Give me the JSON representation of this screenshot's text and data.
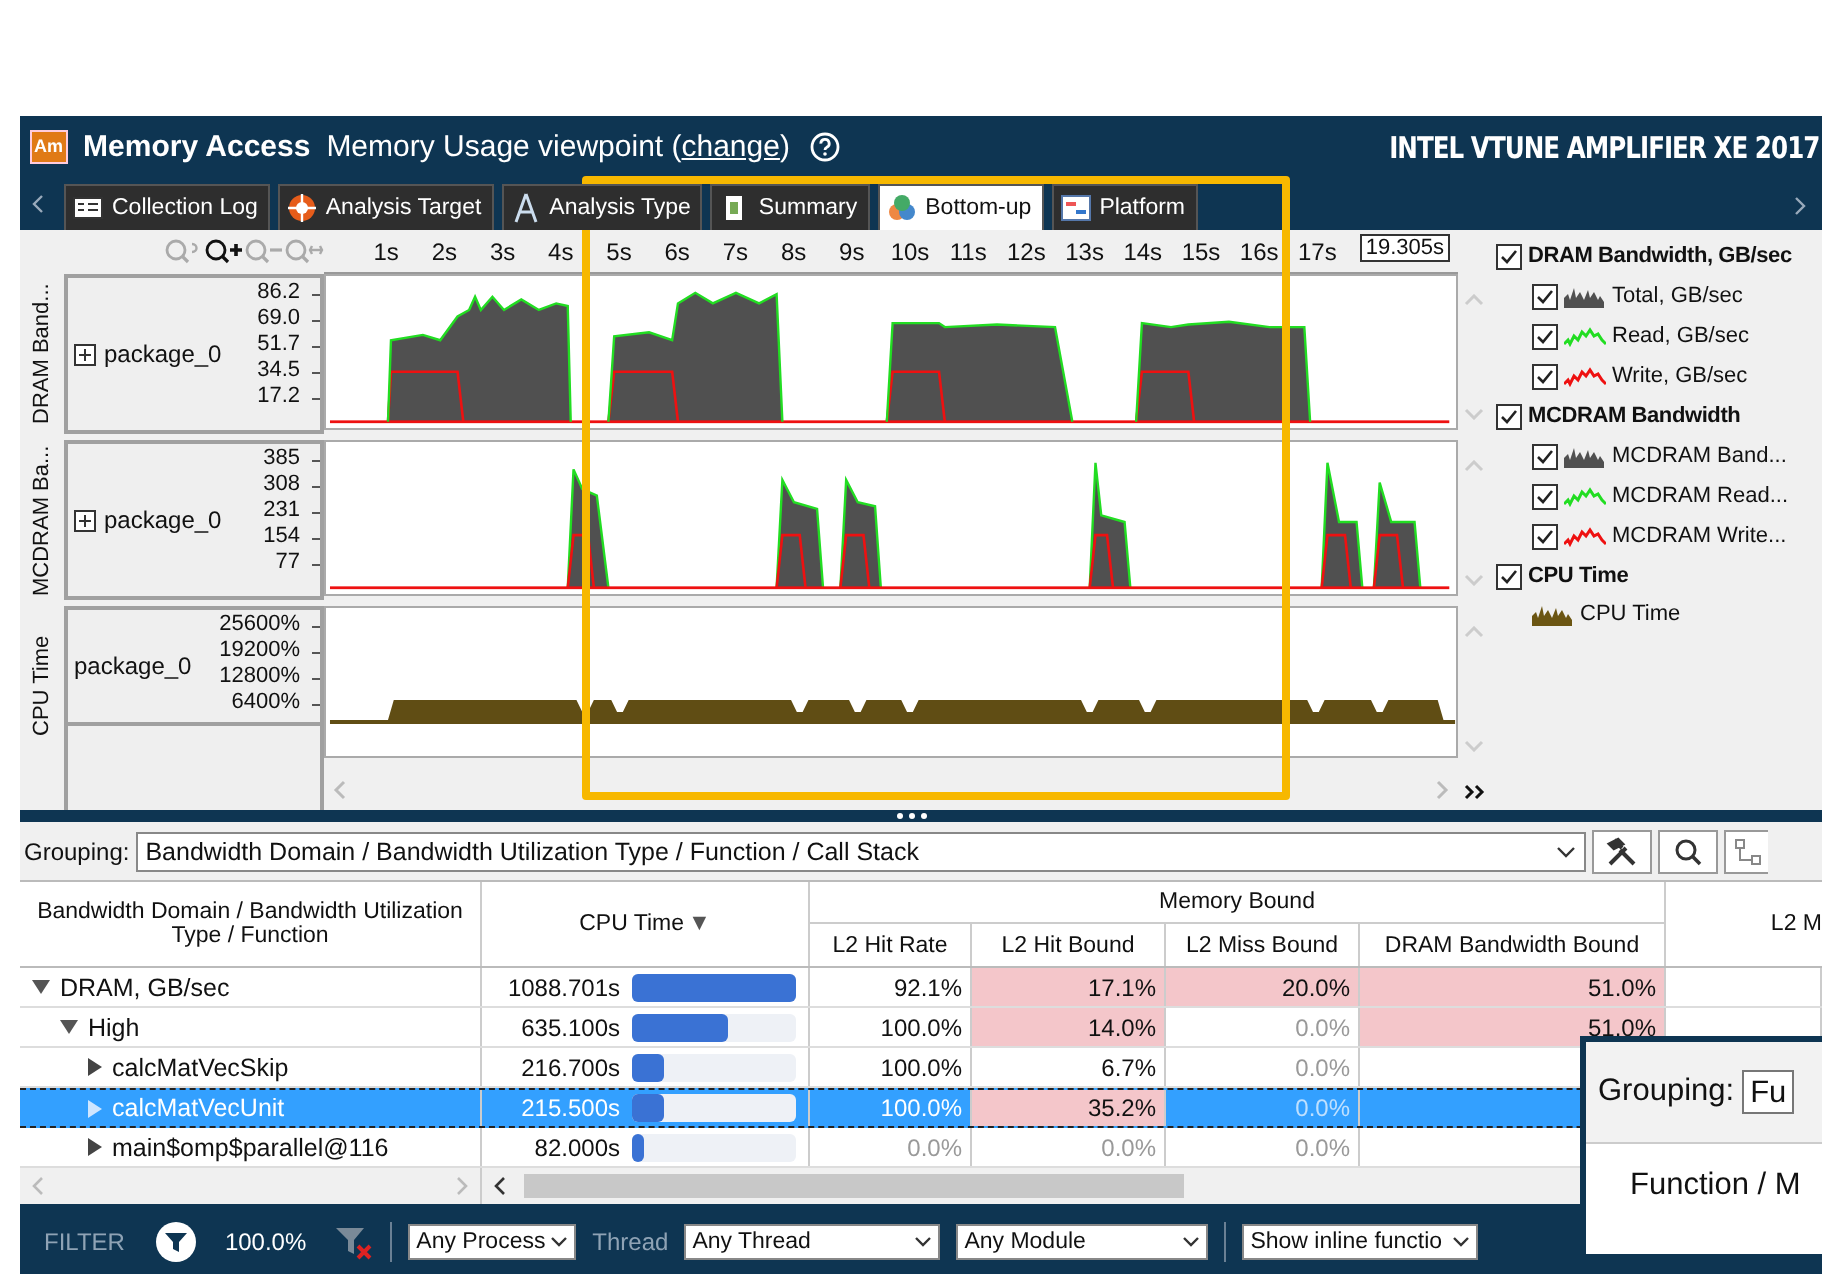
{
  "header": {
    "logo_text": "Am",
    "title": "Memory Access",
    "viewpoint": "Memory Usage viewpoint (",
    "viewpoint_link": "change",
    "viewpoint_end": ")",
    "brand": "INTEL VTUNE AMPLIFIER XE 2017"
  },
  "tabs": [
    {
      "label": "Collection Log",
      "selected": false
    },
    {
      "label": "Analysis Target",
      "selected": false
    },
    {
      "label": "Analysis Type",
      "selected": false
    },
    {
      "label": "Summary",
      "selected": false
    },
    {
      "label": "Bottom-up",
      "selected": true
    },
    {
      "label": "Platform",
      "selected": false
    }
  ],
  "timeline": {
    "time_ticks": [
      "1s",
      "2s",
      "3s",
      "4s",
      "5s",
      "6s",
      "7s",
      "8s",
      "9s",
      "10s",
      "11s",
      "12s",
      "13s",
      "14s",
      "15s",
      "16s",
      "17s"
    ],
    "end_time": "19.305s",
    "rows": [
      {
        "label": "DRAM Band...",
        "item": "package_0",
        "expandable": true,
        "scale": [
          "86.2",
          "69.0",
          "51.7",
          "34.5",
          "17.2"
        ]
      },
      {
        "label": "MCDRAM Ba...",
        "item": "package_0",
        "expandable": true,
        "scale": [
          "385",
          "308",
          "231",
          "154",
          "77"
        ]
      },
      {
        "label": "CPU Time",
        "item": "package_0",
        "expandable": false,
        "scale": [
          "25600%",
          "19200%",
          "12800%",
          "6400%"
        ]
      }
    ]
  },
  "legend": [
    {
      "label": "DRAM Bandwidth, GB/sec",
      "checked": true,
      "children": [
        {
          "label": "Total, GB/sec",
          "checked": true,
          "kind": "area",
          "color": "#505050"
        },
        {
          "label": "Read, GB/sec",
          "checked": true,
          "kind": "line",
          "color": "#22dd22"
        },
        {
          "label": "Write, GB/sec",
          "checked": true,
          "kind": "line",
          "color": "#ee1111"
        }
      ]
    },
    {
      "label": "MCDRAM Bandwidth",
      "checked": true,
      "children": [
        {
          "label": "MCDRAM Band...",
          "checked": true,
          "kind": "area",
          "color": "#505050"
        },
        {
          "label": "MCDRAM Read...",
          "checked": true,
          "kind": "line",
          "color": "#22dd22"
        },
        {
          "label": "MCDRAM Write...",
          "checked": true,
          "kind": "line",
          "color": "#ee1111"
        }
      ]
    },
    {
      "label": "CPU Time",
      "checked": true,
      "children": [
        {
          "label": "CPU Time",
          "kind": "area",
          "color": "#6b5512"
        }
      ]
    }
  ],
  "grouping": {
    "label": "Grouping:",
    "value": "Bandwidth Domain / Bandwidth Utilization Type / Function / Call Stack"
  },
  "table": {
    "columns": {
      "name": "Bandwidth Domain / Bandwidth Utilization Type / Function",
      "cpu_time": "CPU Time",
      "sort_mark": "▼",
      "group": "Memory Bound",
      "metrics": [
        "L2 Hit Rate",
        "L2 Hit Bound",
        "L2 Miss Bound",
        "DRAM Bandwidth Bound"
      ],
      "column_7": "L2 M"
    },
    "rows": [
      {
        "name": "DRAM, GB/sec",
        "expanded": true,
        "selected": false,
        "cpu_time": "1088.701s",
        "level": 1.0,
        "cells": [
          {
            "text": "92.1%",
            "flagged": false,
            "dim": false
          },
          {
            "text": "17.1%",
            "flagged": true,
            "dim": false
          },
          {
            "text": "20.0%",
            "flagged": true,
            "dim": false
          },
          {
            "text": "51.0%",
            "flagged": true,
            "dim": false
          }
        ],
        "children": [
          {
            "name": "High",
            "expanded": true,
            "selected": false,
            "cpu_time": "635.100s",
            "level": 0.58,
            "cells": [
              {
                "text": "100.0%",
                "flagged": false,
                "dim": false
              },
              {
                "text": "14.0%",
                "flagged": true,
                "dim": false
              },
              {
                "text": "0.0%",
                "flagged": false,
                "dim": true
              },
              {
                "text": "51.0%",
                "flagged": true,
                "dim": false
              }
            ],
            "children": [
              {
                "name": "calcMatVecSkip",
                "expanded": false,
                "selected": false,
                "cpu_time": "216.700s",
                "level": 0.2,
                "cells": [
                  {
                    "text": "100.0%",
                    "flagged": false,
                    "dim": false
                  },
                  {
                    "text": "6.7%",
                    "flagged": false,
                    "dim": false
                  },
                  {
                    "text": "0.0%",
                    "flagged": false,
                    "dim": true
                  }
                ]
              },
              {
                "name": "calcMatVecUnit",
                "expanded": false,
                "selected": true,
                "cpu_time": "215.500s",
                "level": 0.2,
                "cells": [
                  {
                    "text": "100.0%",
                    "flagged": false,
                    "dim": false
                  },
                  {
                    "text": "35.2%",
                    "flagged": true,
                    "dim": false
                  },
                  {
                    "text": "0.0%",
                    "flagged": false,
                    "dim": true
                  }
                ]
              },
              {
                "name": "main$omp$parallel@116",
                "expanded": false,
                "selected": false,
                "cpu_time": "82.000s",
                "level": 0.075,
                "cells": [
                  {
                    "text": "0.0%",
                    "flagged": false,
                    "dim": true
                  },
                  {
                    "text": "0.0%",
                    "flagged": false,
                    "dim": true
                  },
                  {
                    "text": "0.0%",
                    "flagged": false,
                    "dim": true
                  }
                ]
              }
            ]
          }
        ]
      }
    ]
  },
  "filter": {
    "label": "FILTER",
    "percent": "100.0%",
    "process": "Any Process",
    "thread_label": "Thread",
    "thread": "Any Thread",
    "module": "Any Module",
    "inline": "Show inline functio"
  },
  "popup": {
    "grouping_label": "Grouping:",
    "grouping_value": "Fu",
    "text": "Function / M"
  }
}
